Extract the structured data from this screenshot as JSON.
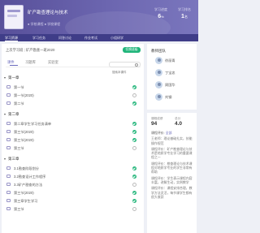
{
  "header": {
    "course_title": "矿产勘查理论与技术",
    "course_sub": "● 学校课程 ● 学校课程",
    "stats": [
      {
        "label": "学习进度",
        "value": "6",
        "unit": "%"
      },
      {
        "label": "学习排名",
        "value": "1",
        "unit": "名"
      }
    ]
  },
  "nav": {
    "tabs": [
      "学习资源",
      "学习任务",
      "问答讨论",
      "作业考试",
      "小组研学"
    ]
  },
  "main": {
    "class_label": "上次学习班",
    "class_sep": "|",
    "class_name": "矿产勘查一班2020",
    "switch_button": "切换班级",
    "tabs": [
      "课件",
      "习题库",
      "实验室"
    ],
    "search_placeholder": "搜索本课件"
  },
  "chapters": [
    {
      "title": "第一章",
      "items": [
        {
          "title": "第一节",
          "done": true
        },
        {
          "title": "第一节(2020)",
          "done": false
        },
        {
          "title": "第二节",
          "done": true
        }
      ]
    },
    {
      "title": "第二章",
      "items": [
        {
          "title": "第二章学生学习任务清单",
          "done": true
        },
        {
          "title": "第三节(2020)",
          "done": true
        },
        {
          "title": "第三节(2020)",
          "done": true
        },
        {
          "title": "第三节",
          "done": false
        }
      ]
    },
    {
      "title": "第三章",
      "items": [
        {
          "title": "3.1勘查阶段划分",
          "done": true
        },
        {
          "title": "3.2勘查设计工作程序",
          "done": true
        },
        {
          "title": "3.3矿产勘查的方法",
          "done": false
        },
        {
          "title": "第三节(2020)",
          "done": true
        },
        {
          "title": "第三章学生学习",
          "done": true
        },
        {
          "title": "第三节",
          "done": false
        }
      ]
    }
  ],
  "sidebar": {
    "teachers_title": "教师团队",
    "teachers": [
      "徐丽青",
      "丁宝忠",
      "周国华",
      "刘钢"
    ],
    "score_labels": [
      "课程成绩",
      "总分"
    ],
    "score_values": [
      "94",
      "4.0"
    ],
    "review": {
      "head": "课程评价:",
      "link": "全部",
      "lines": [
        "王老师：理论基础扎实，技能操作规范",
        "课程评价：矿产勘查理论与技术是地质学专业学习的重要课程之一",
        "课程评价：勘查理论与技术课程对地质学专业的学生非常有帮助",
        "课程评价：学生表示课程内容丰富，讲解生动，实例教学",
        "课程评价：课程安排合理，教学方法灵活，每节课学生都有很大收获"
      ]
    }
  },
  "colors": {
    "banner": "#5d55a2",
    "nav": "#3f3d88",
    "accent": "#6b6bbd",
    "done": "#27b77d"
  }
}
